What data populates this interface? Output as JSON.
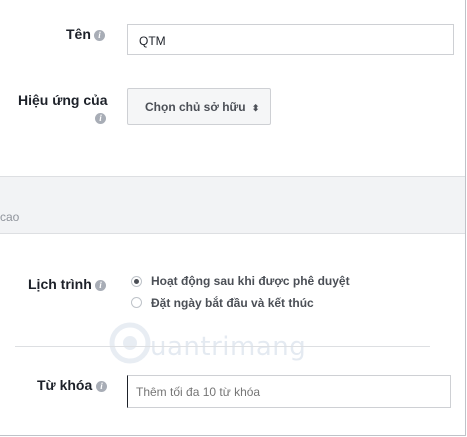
{
  "name_field": {
    "label": "Tên",
    "value": "QTM"
  },
  "effect_field": {
    "label": "Hiệu ứng của",
    "button_label": "Chọn chủ sở hữu",
    "chevron": "⬍"
  },
  "advanced_section": {
    "label": "cao"
  },
  "schedule": {
    "label": "Lịch trình",
    "options": [
      {
        "label": "Hoạt động sau khi được phê duyệt",
        "checked": true
      },
      {
        "label": "Đặt ngày bắt đầu và kết thúc",
        "checked": false
      }
    ]
  },
  "keywords": {
    "label": "Từ khóa",
    "placeholder": "Thêm tối đa 10 từ khóa"
  },
  "watermark": {
    "text": "uantrimang"
  },
  "icons": {
    "info": "i"
  }
}
